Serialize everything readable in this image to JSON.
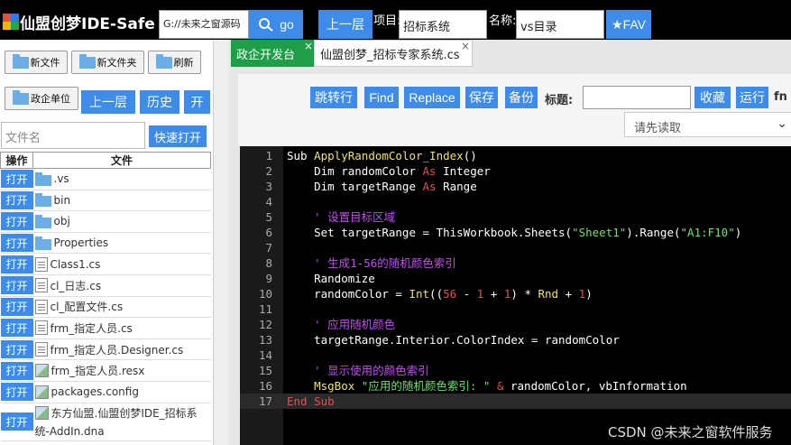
{
  "header": {
    "app_title": "仙盟创梦IDE-Safe",
    "path_value": "G://未来之窗源码",
    "go_label": "go",
    "up_label": "上一层",
    "project_label": "项目:",
    "project_value": "招标系统",
    "name_label": "名称:",
    "name_value": "vs目录",
    "fav_label": "★FAV"
  },
  "sidebar": {
    "new_file": "新文件",
    "new_folder": "新文件夹",
    "refresh": "刷新",
    "gov_unit": "政企单位",
    "up_level": "上一层",
    "history": "历史",
    "open": "开",
    "filename_placeholder": "文件名",
    "quick_open": "快速打开",
    "col_action": "操作",
    "col_file": "文件",
    "open_btn": "打开",
    "files": [
      {
        "name": ".vs",
        "type": "folder"
      },
      {
        "name": "bin",
        "type": "folder"
      },
      {
        "name": "obj",
        "type": "folder"
      },
      {
        "name": "Properties",
        "type": "folder"
      },
      {
        "name": "Class1.cs",
        "type": "file"
      },
      {
        "name": "cl_日志.cs",
        "type": "file"
      },
      {
        "name": "cl_配置文件.cs",
        "type": "file"
      },
      {
        "name": "frm_指定人员.cs",
        "type": "file"
      },
      {
        "name": "frm_指定人员.Designer.cs",
        "type": "file"
      },
      {
        "name": "frm_指定人员.resx",
        "type": "image"
      },
      {
        "name": "packages.config",
        "type": "image"
      },
      {
        "name": "东方仙盟.仙盟创梦IDE_招标系",
        "name2": "统-AddIn.dna",
        "type": "image"
      }
    ]
  },
  "tabs": [
    {
      "label": "政企开发台",
      "close": "×"
    },
    {
      "label": "仙盟创梦_招标专家系统.cs",
      "close": "×"
    }
  ],
  "toolbar": {
    "jump": "跳转行",
    "find": "Find",
    "replace": "Replace",
    "save": "保存",
    "backup": "备份",
    "title_label": "标题:",
    "collect": "收藏",
    "run": "运行",
    "fn": "fn",
    "select_placeholder": "请先读取"
  },
  "code_lines": [
    {
      "n": "1",
      "parts": [
        [
          "kw",
          "Sub "
        ],
        [
          "fnn",
          "ApplyRandomColor_Index"
        ],
        [
          "txt",
          "()"
        ]
      ]
    },
    {
      "n": "2",
      "parts": [
        [
          "txt",
          "    Dim randomColor "
        ],
        [
          "kr",
          "As"
        ],
        [
          "txt",
          " Integer"
        ]
      ]
    },
    {
      "n": "3",
      "parts": [
        [
          "txt",
          "    Dim targetRange "
        ],
        [
          "kr",
          "As"
        ],
        [
          "txt",
          " Range"
        ]
      ]
    },
    {
      "n": "4",
      "parts": []
    },
    {
      "n": "5",
      "parts": [
        [
          "cmt",
          "    ' 设置目标区域"
        ]
      ]
    },
    {
      "n": "6",
      "parts": [
        [
          "txt",
          "    Set targetRange = ThisWorkbook.Sheets("
        ],
        [
          "str",
          "\"Sheet1\""
        ],
        [
          "txt",
          ").Range("
        ],
        [
          "str",
          "\"A1:F10\""
        ],
        [
          "txt",
          ")"
        ]
      ]
    },
    {
      "n": "7",
      "parts": []
    },
    {
      "n": "8",
      "parts": [
        [
          "cmt",
          "    ' 生成1-56的随机颜色索引"
        ]
      ]
    },
    {
      "n": "9",
      "parts": [
        [
          "txt",
          "    Randomize"
        ]
      ]
    },
    {
      "n": "10",
      "parts": [
        [
          "txt",
          "    randomColor = "
        ],
        [
          "fnn",
          "Int"
        ],
        [
          "txt",
          "(("
        ],
        [
          "num",
          "56"
        ],
        [
          "txt",
          " - "
        ],
        [
          "num",
          "1"
        ],
        [
          "txt",
          " + "
        ],
        [
          "num",
          "1"
        ],
        [
          "txt",
          ") * "
        ],
        [
          "fnn",
          "Rnd"
        ],
        [
          "txt",
          " + "
        ],
        [
          "num",
          "1"
        ],
        [
          "txt",
          ")"
        ]
      ]
    },
    {
      "n": "11",
      "parts": []
    },
    {
      "n": "12",
      "parts": [
        [
          "cmt",
          "    ' 应用随机颜色"
        ]
      ]
    },
    {
      "n": "13",
      "parts": [
        [
          "txt",
          "    targetRange.Interior.ColorIndex = randomColor"
        ]
      ]
    },
    {
      "n": "14",
      "parts": []
    },
    {
      "n": "15",
      "parts": [
        [
          "cmt",
          "    ' 显示使用的颜色索引"
        ]
      ]
    },
    {
      "n": "16",
      "parts": [
        [
          "fnn",
          "    MsgBox "
        ],
        [
          "str",
          "\"应用的随机颜色索引: \""
        ],
        [
          "txt",
          " "
        ],
        [
          "kr",
          "&"
        ],
        [
          "txt",
          " randomColor, vbInformation"
        ]
      ]
    },
    {
      "n": "17",
      "parts": [
        [
          "end-kw",
          "End Sub"
        ]
      ]
    }
  ],
  "watermark": "CSDN @未来之窗软件服务",
  "colors": {
    "accent": "#3d8bea",
    "tab_active": "#1e9e47",
    "editor_bg": "#000000"
  }
}
